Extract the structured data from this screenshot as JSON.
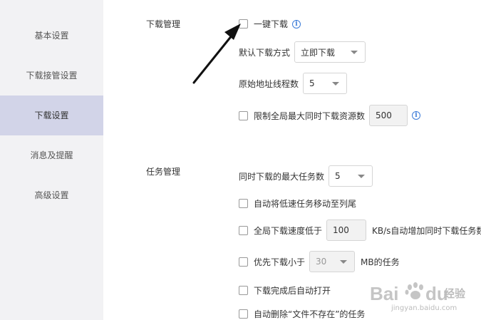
{
  "sidebar": {
    "items": [
      {
        "label": "基本设置"
      },
      {
        "label": "下载接管设置"
      },
      {
        "label": "下载设置"
      },
      {
        "label": "消息及提醒"
      },
      {
        "label": "高级设置"
      }
    ],
    "active_index": 2
  },
  "download_management": {
    "title": "下载管理",
    "one_click": {
      "label": "一键下载"
    },
    "default_mode": {
      "label": "默认下载方式",
      "value": "立即下载"
    },
    "thread_count": {
      "label": "原始地址线程数",
      "value": "5"
    },
    "limit_resources": {
      "label": "限制全局最大同时下载资源数",
      "value": "500"
    }
  },
  "task_management": {
    "title": "任务管理",
    "max_tasks": {
      "label": "同时下载的最大任务数",
      "value": "5"
    },
    "move_slow": {
      "label": "自动将低速任务移动至列尾"
    },
    "speed_below": {
      "label": "全局下载速度低于",
      "value": "100",
      "suffix": "KB/s自动增加同时下载任务数"
    },
    "prefer_small": {
      "label": "优先下载小于",
      "value": "30",
      "suffix": "MB的任务"
    },
    "auto_open": {
      "label": "下载完成后自动打开"
    },
    "auto_delete": {
      "label": "自动删除“文件不存在”的任务"
    }
  },
  "watermark": {
    "brand": "Baidu经验",
    "url": "jingyan.baidu.com"
  },
  "colors": {
    "sidebar_bg": "#f2f2f4",
    "active_bg": "#d2d4e8",
    "info_blue": "#3b7bd8",
    "arrow": "#111111"
  }
}
